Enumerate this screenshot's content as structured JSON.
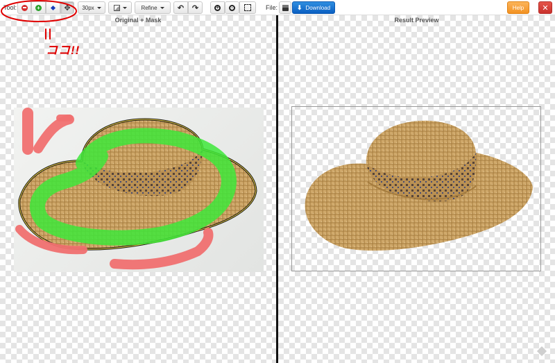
{
  "toolbar": {
    "tool_label": "Tool:",
    "brush_size": "30px",
    "refine_label": "Refine",
    "file_label": "File:",
    "download_label": "Download",
    "help_label": "Help",
    "close_label": "✕"
  },
  "panes": {
    "left_title": "Original + Mask",
    "right_title": "Result Preview"
  },
  "annotation": {
    "text": "ココ!!"
  },
  "colors": {
    "keep_mask": "#3ee83a",
    "remove_mask": "#f07070",
    "annotation": "#e00000",
    "download": "#0a6bd6",
    "help": "#f5a030",
    "close": "#d9423a"
  },
  "icons": [
    "remove-tool-icon",
    "keep-tool-icon",
    "hair-tool-icon",
    "pan-tool-icon",
    "view-mode-icon",
    "undo-icon",
    "redo-icon",
    "zoom-in-icon",
    "zoom-out-icon",
    "fit-icon",
    "save-icon",
    "download-icon"
  ]
}
